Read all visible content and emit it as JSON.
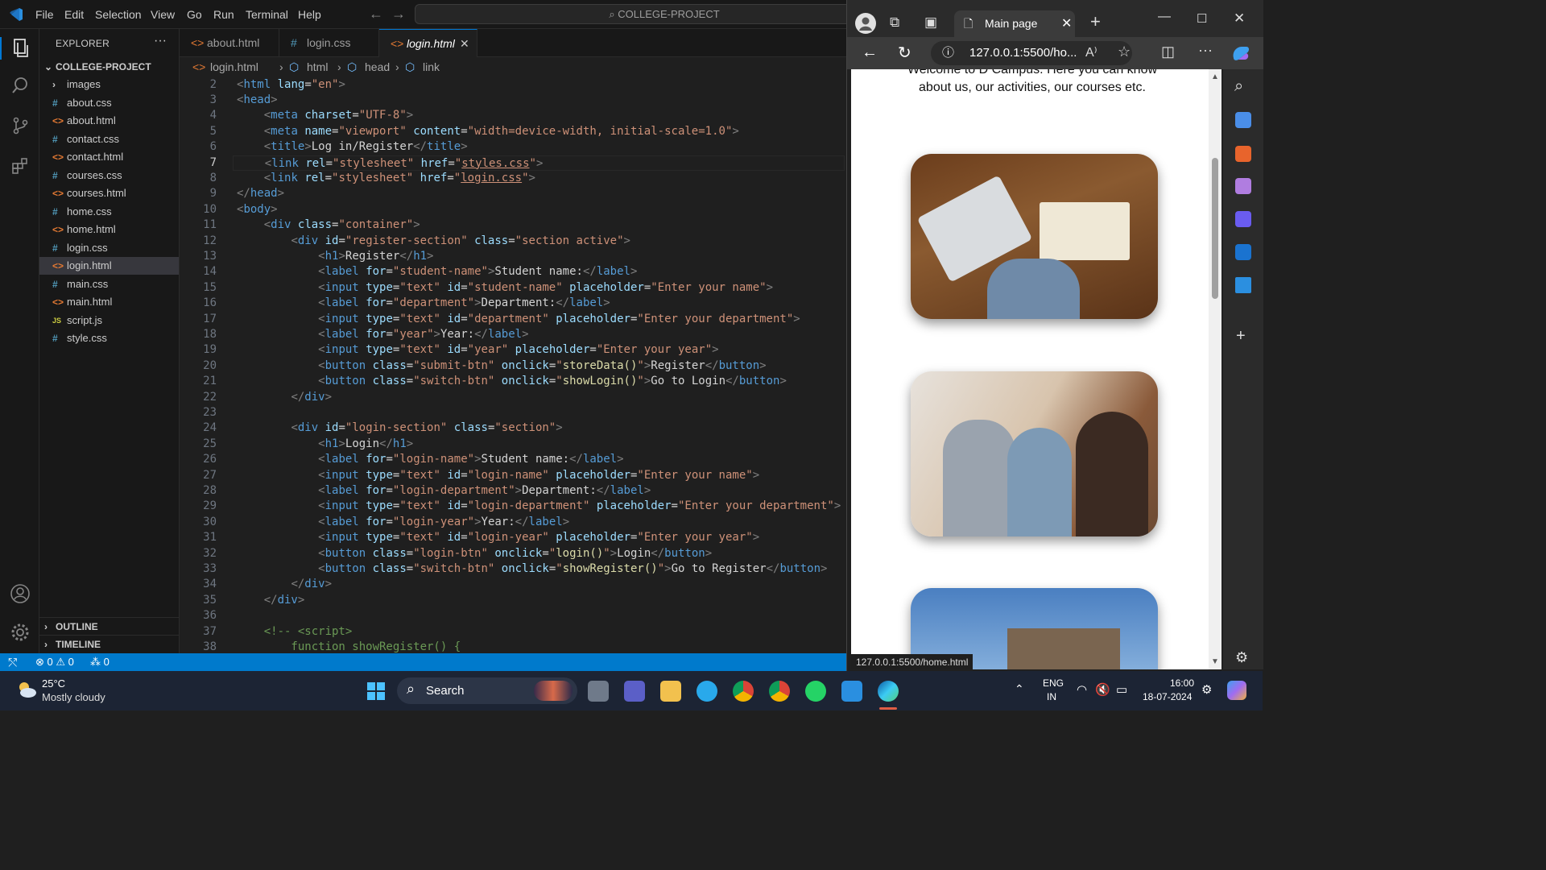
{
  "menu": [
    "File",
    "Edit",
    "Selection",
    "View",
    "Go",
    "Run",
    "Terminal",
    "Help"
  ],
  "command_center": "COLLEGE-PROJECT",
  "explorer": {
    "title": "EXPLORER",
    "project": "COLLEGE-PROJECT",
    "files": [
      {
        "name": "images",
        "kind": "folder"
      },
      {
        "name": "about.css",
        "kind": "css"
      },
      {
        "name": "about.html",
        "kind": "html"
      },
      {
        "name": "contact.css",
        "kind": "css"
      },
      {
        "name": "contact.html",
        "kind": "html"
      },
      {
        "name": "courses.css",
        "kind": "css"
      },
      {
        "name": "courses.html",
        "kind": "html"
      },
      {
        "name": "home.css",
        "kind": "css"
      },
      {
        "name": "home.html",
        "kind": "html"
      },
      {
        "name": "login.css",
        "kind": "css"
      },
      {
        "name": "login.html",
        "kind": "html",
        "active": true
      },
      {
        "name": "main.css",
        "kind": "css"
      },
      {
        "name": "main.html",
        "kind": "html"
      },
      {
        "name": "script.js",
        "kind": "js"
      },
      {
        "name": "style.css",
        "kind": "css"
      }
    ],
    "outline": "OUTLINE",
    "timeline": "TIMELINE"
  },
  "tabs": [
    {
      "label": "about.html",
      "kind": "html"
    },
    {
      "label": "login.css",
      "kind": "css"
    },
    {
      "label": "login.html",
      "kind": "html",
      "active": true
    }
  ],
  "breadcrumb": [
    "login.html",
    "html",
    "head",
    "link"
  ],
  "code_lines": [
    {
      "n": "2",
      "html": "<span class=\"p\">&lt;</span><span class=\"t\">html</span> <span class=\"a\">lang</span><span class=\"w\">=</span><span class=\"s\">\"en\"</span><span class=\"p\">&gt;</span>"
    },
    {
      "n": "3",
      "html": "<span class=\"p\">&lt;</span><span class=\"t\">head</span><span class=\"p\">&gt;</span>"
    },
    {
      "n": "4",
      "html": "    <span class=\"p\">&lt;</span><span class=\"t\">meta</span> <span class=\"a\">charset</span><span class=\"w\">=</span><span class=\"s\">\"UTF-8\"</span><span class=\"p\">&gt;</span>"
    },
    {
      "n": "5",
      "html": "    <span class=\"p\">&lt;</span><span class=\"t\">meta</span> <span class=\"a\">name</span><span class=\"w\">=</span><span class=\"s\">\"viewport\"</span> <span class=\"a\">content</span><span class=\"w\">=</span><span class=\"s\">\"width=device-width, initial-scale=1.0\"</span><span class=\"p\">&gt;</span>"
    },
    {
      "n": "6",
      "html": "    <span class=\"p\">&lt;</span><span class=\"t\">title</span><span class=\"p\">&gt;</span><span class=\"w\">Log in/Register</span><span class=\"p\">&lt;/</span><span class=\"t\">title</span><span class=\"p\">&gt;</span>"
    },
    {
      "n": "7",
      "cur": true,
      "html": "    <span class=\"p\">&lt;</span><span class=\"t\">link</span> <span class=\"a\">rel</span><span class=\"w\">=</span><span class=\"s\">\"stylesheet\"</span> <span class=\"a\">href</span><span class=\"w\">=</span><span class=\"s\">\"<u>styles.css</u>\"</span><span class=\"p\">&gt;</span>"
    },
    {
      "n": "8",
      "html": "    <span class=\"p\">&lt;</span><span class=\"t\">link</span> <span class=\"a\">rel</span><span class=\"w\">=</span><span class=\"s\">\"stylesheet\"</span> <span class=\"a\">href</span><span class=\"w\">=</span><span class=\"s\">\"<u>login.css</u>\"</span><span class=\"p\">&gt;</span>"
    },
    {
      "n": "9",
      "html": "<span class=\"p\">&lt;/</span><span class=\"t\">head</span><span class=\"p\">&gt;</span>"
    },
    {
      "n": "10",
      "html": "<span class=\"p\">&lt;</span><span class=\"t\">body</span><span class=\"p\">&gt;</span>"
    },
    {
      "n": "11",
      "html": "    <span class=\"p\">&lt;</span><span class=\"t\">div</span> <span class=\"a\">class</span><span class=\"w\">=</span><span class=\"s\">\"container\"</span><span class=\"p\">&gt;</span>"
    },
    {
      "n": "12",
      "html": "        <span class=\"p\">&lt;</span><span class=\"t\">div</span> <span class=\"a\">id</span><span class=\"w\">=</span><span class=\"s\">\"register-section\"</span> <span class=\"a\">class</span><span class=\"w\">=</span><span class=\"s\">\"section active\"</span><span class=\"p\">&gt;</span>"
    },
    {
      "n": "13",
      "html": "            <span class=\"p\">&lt;</span><span class=\"t\">h1</span><span class=\"p\">&gt;</span><span class=\"w\">Register</span><span class=\"p\">&lt;/</span><span class=\"t\">h1</span><span class=\"p\">&gt;</span>"
    },
    {
      "n": "14",
      "html": "            <span class=\"p\">&lt;</span><span class=\"t\">label</span> <span class=\"a\">for</span><span class=\"w\">=</span><span class=\"s\">\"student-name\"</span><span class=\"p\">&gt;</span><span class=\"w\">Student name:</span><span class=\"p\">&lt;/</span><span class=\"t\">label</span><span class=\"p\">&gt;</span>"
    },
    {
      "n": "15",
      "html": "            <span class=\"p\">&lt;</span><span class=\"t\">input</span> <span class=\"a\">type</span><span class=\"w\">=</span><span class=\"s\">\"text\"</span> <span class=\"a\">id</span><span class=\"w\">=</span><span class=\"s\">\"student-name\"</span> <span class=\"a\">placeholder</span><span class=\"w\">=</span><span class=\"s\">\"Enter your name\"</span><span class=\"p\">&gt;</span>"
    },
    {
      "n": "16",
      "html": "            <span class=\"p\">&lt;</span><span class=\"t\">label</span> <span class=\"a\">for</span><span class=\"w\">=</span><span class=\"s\">\"department\"</span><span class=\"p\">&gt;</span><span class=\"w\">Department:</span><span class=\"p\">&lt;/</span><span class=\"t\">label</span><span class=\"p\">&gt;</span>"
    },
    {
      "n": "17",
      "html": "            <span class=\"p\">&lt;</span><span class=\"t\">input</span> <span class=\"a\">type</span><span class=\"w\">=</span><span class=\"s\">\"text\"</span> <span class=\"a\">id</span><span class=\"w\">=</span><span class=\"s\">\"department\"</span> <span class=\"a\">placeholder</span><span class=\"w\">=</span><span class=\"s\">\"Enter your department\"</span><span class=\"p\">&gt;</span>"
    },
    {
      "n": "18",
      "html": "            <span class=\"p\">&lt;</span><span class=\"t\">label</span> <span class=\"a\">for</span><span class=\"w\">=</span><span class=\"s\">\"year\"</span><span class=\"p\">&gt;</span><span class=\"w\">Year:</span><span class=\"p\">&lt;/</span><span class=\"t\">label</span><span class=\"p\">&gt;</span>"
    },
    {
      "n": "19",
      "html": "            <span class=\"p\">&lt;</span><span class=\"t\">input</span> <span class=\"a\">type</span><span class=\"w\">=</span><span class=\"s\">\"text\"</span> <span class=\"a\">id</span><span class=\"w\">=</span><span class=\"s\">\"year\"</span> <span class=\"a\">placeholder</span><span class=\"w\">=</span><span class=\"s\">\"Enter your year\"</span><span class=\"p\">&gt;</span>"
    },
    {
      "n": "20",
      "html": "            <span class=\"p\">&lt;</span><span class=\"t\">button</span> <span class=\"a\">class</span><span class=\"w\">=</span><span class=\"s\">\"submit-btn\"</span> <span class=\"a\">onclick</span><span class=\"w\">=</span><span class=\"s\">\"</span><span class=\"y\">storeData</span><span class=\"y\">()</span><span class=\"s\">\"</span><span class=\"p\">&gt;</span><span class=\"w\">Register</span><span class=\"p\">&lt;/</span><span class=\"t\">button</span><span class=\"p\">&gt;</span>"
    },
    {
      "n": "21",
      "html": "            <span class=\"p\">&lt;</span><span class=\"t\">button</span> <span class=\"a\">class</span><span class=\"w\">=</span><span class=\"s\">\"switch-btn\"</span> <span class=\"a\">onclick</span><span class=\"w\">=</span><span class=\"s\">\"</span><span class=\"y\">showLogin</span><span class=\"y\">()</span><span class=\"s\">\"</span><span class=\"p\">&gt;</span><span class=\"w\">Go to Login</span><span class=\"p\">&lt;/</span><span class=\"t\">button</span><span class=\"p\">&gt;</span>"
    },
    {
      "n": "22",
      "html": "        <span class=\"p\">&lt;/</span><span class=\"t\">div</span><span class=\"p\">&gt;</span>"
    },
    {
      "n": "23",
      "html": ""
    },
    {
      "n": "24",
      "html": "        <span class=\"p\">&lt;</span><span class=\"t\">div</span> <span class=\"a\">id</span><span class=\"w\">=</span><span class=\"s\">\"login-section\"</span> <span class=\"a\">class</span><span class=\"w\">=</span><span class=\"s\">\"section\"</span><span class=\"p\">&gt;</span>"
    },
    {
      "n": "25",
      "html": "            <span class=\"p\">&lt;</span><span class=\"t\">h1</span><span class=\"p\">&gt;</span><span class=\"w\">Login</span><span class=\"p\">&lt;/</span><span class=\"t\">h1</span><span class=\"p\">&gt;</span>"
    },
    {
      "n": "26",
      "html": "            <span class=\"p\">&lt;</span><span class=\"t\">label</span> <span class=\"a\">for</span><span class=\"w\">=</span><span class=\"s\">\"login-name\"</span><span class=\"p\">&gt;</span><span class=\"w\">Student name:</span><span class=\"p\">&lt;/</span><span class=\"t\">label</span><span class=\"p\">&gt;</span>"
    },
    {
      "n": "27",
      "html": "            <span class=\"p\">&lt;</span><span class=\"t\">input</span> <span class=\"a\">type</span><span class=\"w\">=</span><span class=\"s\">\"text\"</span> <span class=\"a\">id</span><span class=\"w\">=</span><span class=\"s\">\"login-name\"</span> <span class=\"a\">placeholder</span><span class=\"w\">=</span><span class=\"s\">\"Enter your name\"</span><span class=\"p\">&gt;</span>"
    },
    {
      "n": "28",
      "html": "            <span class=\"p\">&lt;</span><span class=\"t\">label</span> <span class=\"a\">for</span><span class=\"w\">=</span><span class=\"s\">\"login-department\"</span><span class=\"p\">&gt;</span><span class=\"w\">Department:</span><span class=\"p\">&lt;/</span><span class=\"t\">label</span><span class=\"p\">&gt;</span>"
    },
    {
      "n": "29",
      "html": "            <span class=\"p\">&lt;</span><span class=\"t\">input</span> <span class=\"a\">type</span><span class=\"w\">=</span><span class=\"s\">\"text\"</span> <span class=\"a\">id</span><span class=\"w\">=</span><span class=\"s\">\"login-department\"</span> <span class=\"a\">placeholder</span><span class=\"w\">=</span><span class=\"s\">\"Enter your department\"</span><span class=\"p\">&gt;</span>"
    },
    {
      "n": "30",
      "html": "            <span class=\"p\">&lt;</span><span class=\"t\">label</span> <span class=\"a\">for</span><span class=\"w\">=</span><span class=\"s\">\"login-year\"</span><span class=\"p\">&gt;</span><span class=\"w\">Year:</span><span class=\"p\">&lt;/</span><span class=\"t\">label</span><span class=\"p\">&gt;</span>"
    },
    {
      "n": "31",
      "html": "            <span class=\"p\">&lt;</span><span class=\"t\">input</span> <span class=\"a\">type</span><span class=\"w\">=</span><span class=\"s\">\"text\"</span> <span class=\"a\">id</span><span class=\"w\">=</span><span class=\"s\">\"login-year\"</span> <span class=\"a\">placeholder</span><span class=\"w\">=</span><span class=\"s\">\"Enter your year\"</span><span class=\"p\">&gt;</span>"
    },
    {
      "n": "32",
      "html": "            <span class=\"p\">&lt;</span><span class=\"t\">button</span> <span class=\"a\">class</span><span class=\"w\">=</span><span class=\"s\">\"login-btn\"</span> <span class=\"a\">onclick</span><span class=\"w\">=</span><span class=\"s\">\"</span><span class=\"y\">login</span><span class=\"y\">()</span><span class=\"s\">\"</span><span class=\"p\">&gt;</span><span class=\"w\">Login</span><span class=\"p\">&lt;/</span><span class=\"t\">button</span><span class=\"p\">&gt;</span>"
    },
    {
      "n": "33",
      "html": "            <span class=\"p\">&lt;</span><span class=\"t\">button</span> <span class=\"a\">class</span><span class=\"w\">=</span><span class=\"s\">\"switch-btn\"</span> <span class=\"a\">onclick</span><span class=\"w\">=</span><span class=\"s\">\"</span><span class=\"y\">showRegister</span><span class=\"y\">()</span><span class=\"s\">\"</span><span class=\"p\">&gt;</span><span class=\"w\">Go to Register</span><span class=\"p\">&lt;/</span><span class=\"t\">button</span><span class=\"p\">&gt;</span>"
    },
    {
      "n": "34",
      "html": "        <span class=\"p\">&lt;/</span><span class=\"t\">div</span><span class=\"p\">&gt;</span>"
    },
    {
      "n": "35",
      "html": "    <span class=\"p\">&lt;/</span><span class=\"t\">div</span><span class=\"p\">&gt;</span>"
    },
    {
      "n": "36",
      "html": ""
    },
    {
      "n": "37",
      "html": "    <span class=\"c\">&lt;!-- &lt;script&gt;</span>"
    },
    {
      "n": "38",
      "html": "<span class=\"c\">        function showRegister() {</span>"
    }
  ],
  "status": {
    "errors": "0",
    "warnings": "0",
    "ports": "0"
  },
  "browser": {
    "tab_title": "Main page",
    "url": "127.0.0.1:5500/ho...",
    "status_url": "127.0.0.1:5500/home.html",
    "intro_line1": "Welcome to D Campus. Here you can know",
    "intro_line2": "about us, our activities, our courses etc."
  },
  "taskbar": {
    "temp": "25°C",
    "weather": "Mostly cloudy",
    "search": "Search",
    "lang1": "ENG",
    "lang2": "IN",
    "time": "16:00",
    "date": "18-07-2024"
  },
  "colors": {
    "accent": "#007acc",
    "editor_bg": "#1f1f1f",
    "sidebar_bg": "#181818"
  }
}
